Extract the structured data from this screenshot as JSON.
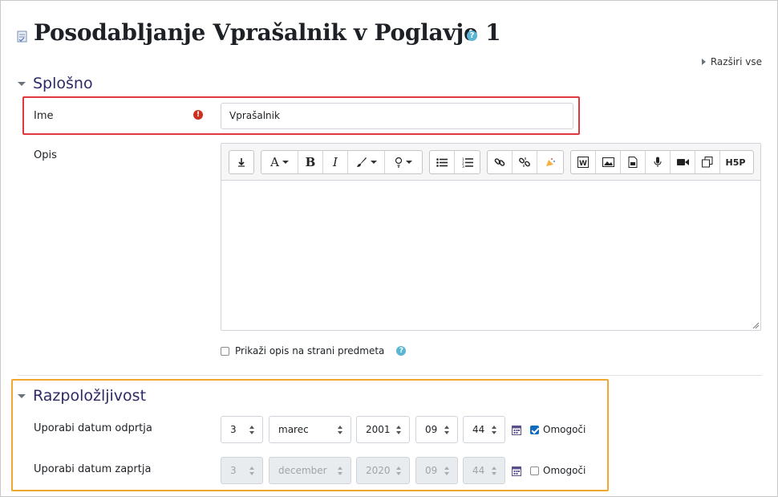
{
  "page": {
    "title": "Posodabljanje Vprašalnik v Poglavje 1",
    "expand_all": "Razširi vse"
  },
  "sections": {
    "general": {
      "title": "Splošno"
    },
    "availability": {
      "title": "Razpoložljivost"
    }
  },
  "form": {
    "name": {
      "label": "Ime",
      "value": "Vprašalnik"
    },
    "description": {
      "label": "Opis"
    },
    "show_description": {
      "label": "Prikaži opis na strani predmeta",
      "checked": false
    },
    "open_date": {
      "label": "Uporabi datum odprtja",
      "day": "3",
      "month": "marec",
      "year": "2001",
      "hour": "09",
      "minute": "44",
      "enable_label": "Omogoči",
      "enabled": true
    },
    "close_date": {
      "label": "Uporabi datum zaprtja",
      "day": "3",
      "month": "december",
      "year": "2020",
      "hour": "09",
      "minute": "44",
      "enable_label": "Omogoči",
      "enabled": false
    }
  },
  "editor_toolbar": {
    "groups": [
      [
        "collapse-icon"
      ],
      [
        "styles-icon",
        "bold-icon",
        "italic-icon",
        "font-color-icon",
        "background-color-icon"
      ],
      [
        "unordered-list-icon",
        "ordered-list-icon"
      ],
      [
        "link-icon",
        "unlink-icon",
        "emoji-icon"
      ],
      [
        "word-import-icon",
        "image-icon",
        "media-icon",
        "record-audio-icon",
        "record-video-icon",
        "manage-files-icon",
        "h5p-icon"
      ]
    ],
    "labels": {
      "styles": "A",
      "bold": "B",
      "italic": "I",
      "h5p": "H5P"
    }
  },
  "colors": {
    "heading": "#2e2a66",
    "required": "#ca3120",
    "help": "#5bb5d5",
    "highlight_red": "#e0383e",
    "highlight_orange": "#f0a830",
    "checkbox_checked": "#0f6cbf"
  }
}
